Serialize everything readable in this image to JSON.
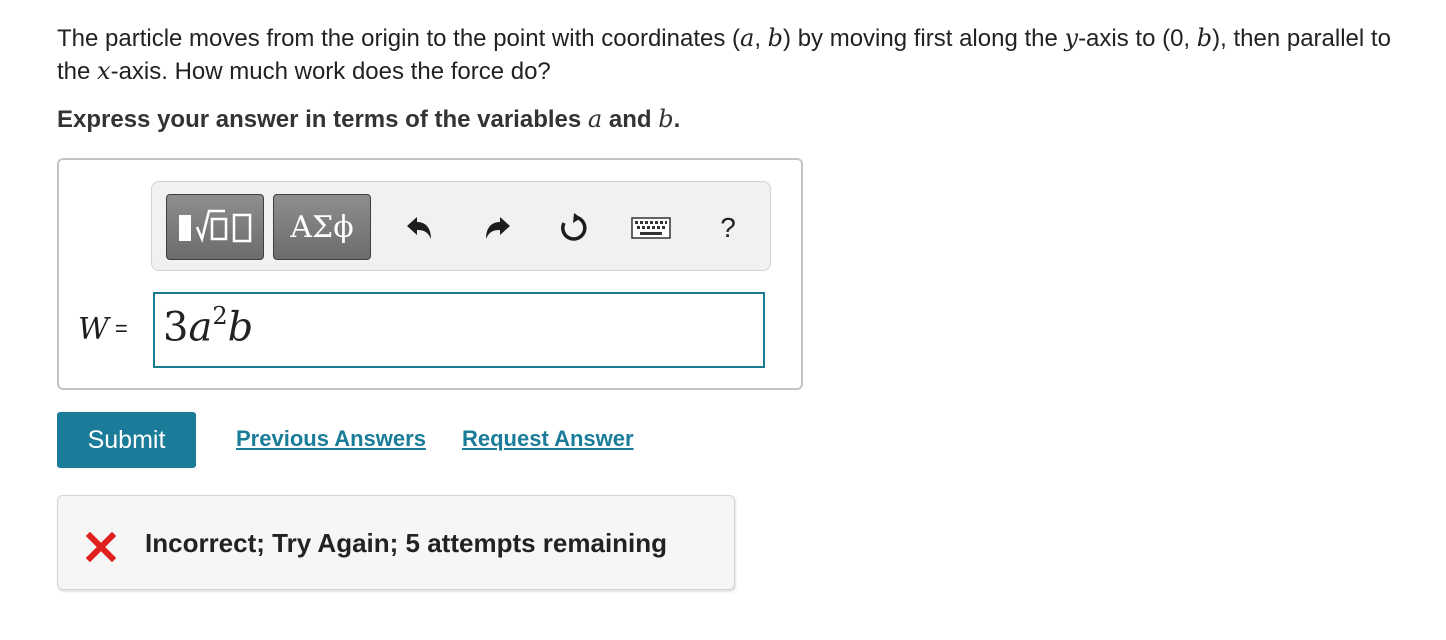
{
  "question": {
    "text_1": "The particle moves from the origin to the point with coordinates (",
    "var_a": "a",
    "text_comma": ", ",
    "var_b": "b",
    "text_2": ") by moving first along the ",
    "var_y": "y",
    "text_3": "-axis to (0, ",
    "var_b2": "b",
    "text_4": "), then parallel to the ",
    "var_x": "x",
    "text_5": "-axis. How much work does the force do?"
  },
  "instruction": {
    "text_1": "Express your answer in terms of the variables ",
    "var_a": "a",
    "text_and": " and ",
    "var_b": "b",
    "text_end": "."
  },
  "toolbar": {
    "greek_label": "ΑΣϕ",
    "help_label": "?",
    "icons": [
      "templates-icon",
      "undo-icon",
      "redo-icon",
      "reset-icon",
      "keyboard-icon",
      "help-icon"
    ]
  },
  "answer": {
    "variable": "W",
    "equals": "=",
    "coefficient": "3",
    "base_a": "a",
    "exponent": "2",
    "base_b": "b"
  },
  "actions": {
    "submit_label": "Submit",
    "previous_answers_label": "Previous Answers",
    "request_answer_label": "Request Answer"
  },
  "feedback": {
    "message": "Incorrect; Try Again; 5 attempts remaining",
    "icon": "x-icon",
    "icon_color": "#e0201f"
  },
  "colors": {
    "accent": "#1a7c99",
    "input_border": "#1a7c93",
    "toolbar_button": "#7a7a7a"
  }
}
